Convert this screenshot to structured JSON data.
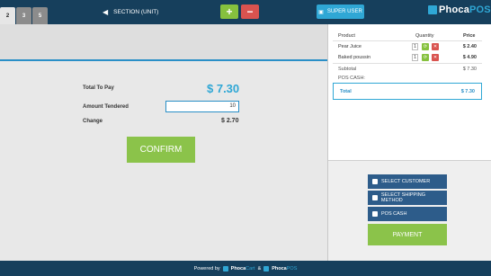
{
  "tabs": [
    "2",
    "3",
    "5"
  ],
  "toolbar": {
    "section_label": "SECTION (UNIT)",
    "add_label": "+",
    "remove_label": "−",
    "user_label": "SUPER USER"
  },
  "logo": {
    "phoca": "Phoca",
    "pos": "POS"
  },
  "payment": {
    "total_label": "Total To Pay",
    "total_value": "$ 7.30",
    "amount_label": "Amount Tendered",
    "amount_value": "10",
    "change_label": "Change",
    "change_value": "$ 2.70",
    "confirm_label": "CONFIRM"
  },
  "cart": {
    "headers": {
      "product": "Product",
      "quantity": "Quantity",
      "price": "Price"
    },
    "items": [
      {
        "name": "Pear Juice",
        "qty": "1",
        "price": "$ 2.40"
      },
      {
        "name": "Baked poussin",
        "qty": "1",
        "price": "$ 4.90"
      }
    ],
    "subtotal_label": "Subtotal",
    "subtotal_value": "$ 7.30",
    "pos_cash_label": "POS CASH:",
    "total_label": "Total",
    "total_value": "$ 7.30"
  },
  "actions": {
    "select_customer": "SELECT CUSTOMER",
    "select_shipping": "SELECT SHIPPING METHOD",
    "pos_cash": "POS CASH",
    "payment": "PAYMENT"
  },
  "footer": {
    "powered_by": "Powered by",
    "cart_a": "Phoca",
    "cart_b": "Cart",
    "amp": "&",
    "pos_a": "Phoca",
    "pos_b": "POS"
  },
  "colors": {
    "header_bg": "#163f5c",
    "accent_blue": "#2fa7d5",
    "confirm_green": "#8bc34a",
    "danger_red": "#d9534f",
    "action_blue": "#2d5c8a"
  }
}
